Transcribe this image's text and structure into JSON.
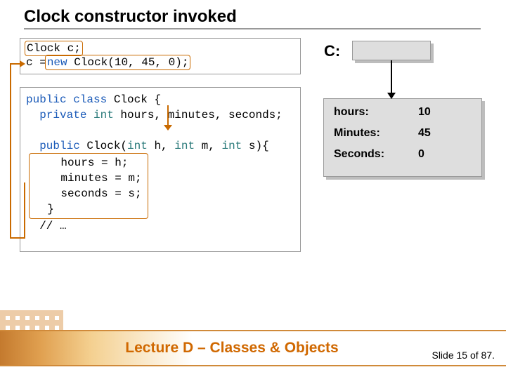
{
  "title": "Clock constructor invoked",
  "code1": {
    "l1a": "Clock c;",
    "l2a": "c =",
    "l2b": " new",
    "l2c": " Clock(10, 45, 0);"
  },
  "code2": {
    "l1a": "public",
    "l1b": " class",
    "l1c": " Clock {",
    "l2a": "  private",
    "l2b": " int",
    "l2c": " hours, minutes, seconds;",
    "gap": "",
    "l3a": "  public",
    "l3b": " Clock(",
    "l3c": "int",
    "l3d": " h, ",
    "l3e": "int",
    "l3f": " m, ",
    "l3g": "int",
    "l3h": " s){",
    "l4": "    hours = h;",
    "l5": "    minutes = m;",
    "l6": "    seconds = s;",
    "l7": "  }",
    "l8": "  // …"
  },
  "c_label": "C:",
  "object": {
    "hours_label": "hours:",
    "hours_val": "10",
    "minutes_label": "Minutes:",
    "minutes_val": "45",
    "seconds_label": "Seconds:",
    "seconds_val": "0"
  },
  "footer": "Lecture D – Classes & Objects",
  "slide_info": "Slide 15 of 87."
}
